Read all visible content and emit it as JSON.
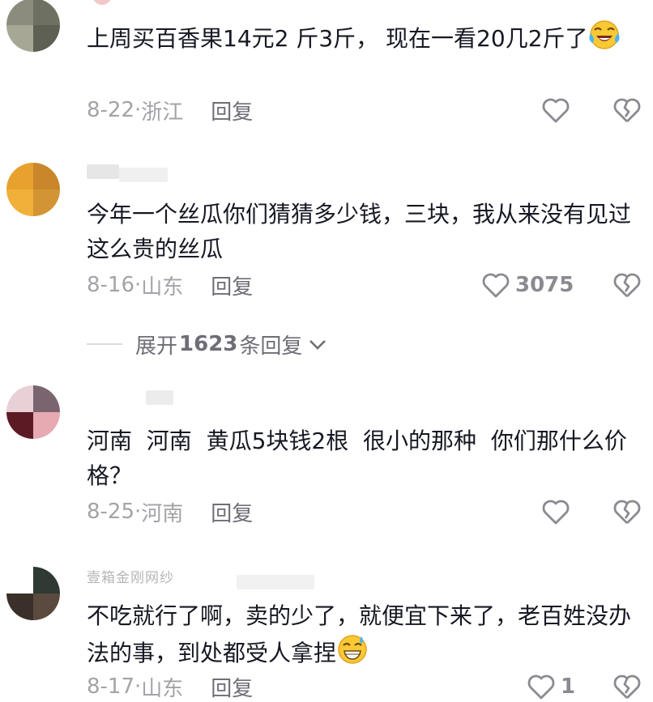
{
  "comments": [
    {
      "text": "上周买百香果14元2 斤3斤， 现在一看20几2斤了",
      "emoji": "laugh-cry",
      "date": "8-22",
      "location": "浙江",
      "reply_label": "回复",
      "like_count": ""
    },
    {
      "text": "今年一个丝瓜你们猜猜多少钱，三块，我从来没有见过这么贵的丝瓜",
      "date": "8-16",
      "location": "山东",
      "reply_label": "回复",
      "like_count": "3075"
    },
    {
      "text": "河南  河南  黄瓜5块钱2根  很小的那种  你们那什么价格？",
      "date": "8-25",
      "location": "河南",
      "reply_label": "回复",
      "like_count": ""
    },
    {
      "username_partial": "壹箱金刚网纱",
      "text": "不吃就行了啊，卖的少了，就便宜下来了，老百姓没办法的事，到处都受人拿捏",
      "emoji": "grin-sweat",
      "date": "8-17",
      "location": "山东",
      "reply_label": "回复",
      "like_count": "1"
    }
  ],
  "expand_replies": {
    "prefix": "展开",
    "count": "1623",
    "suffix": "条回复"
  },
  "colors": {
    "text": "#161823",
    "meta": "#a3a3a8",
    "icon": "#8a8b91"
  }
}
